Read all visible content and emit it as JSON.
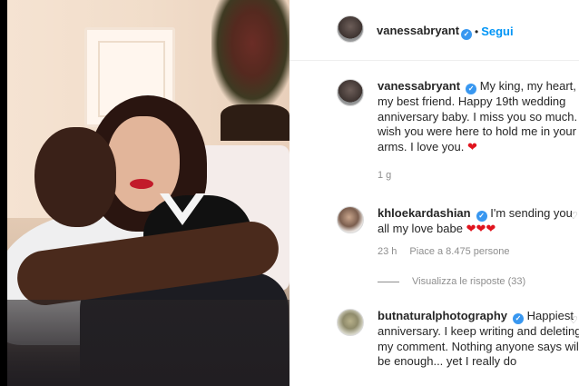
{
  "post": {
    "author": "vanessabryant",
    "follow_label": "Segui",
    "separator": "•"
  },
  "comments": [
    {
      "username": "vanessabryant",
      "text": "My king, my heart, my best friend. Happy 19th wedding anniversary baby. I miss you so much. I wish you were here to hold me in your arms. I love you.",
      "emoji": "❤",
      "time": "1 g"
    },
    {
      "username": "khloekardashian",
      "text": "I'm sending you all my love babe",
      "emoji": "❤❤❤",
      "time": "23 h",
      "likes": "Piace a 8.475 persone",
      "replies_label": "Visualizza le risposte (33)"
    },
    {
      "username": "butnaturalphotography",
      "text": "Happiest anniversary. I keep writing and deleting my comment. Nothing anyone says will be enough... yet I really do"
    }
  ],
  "icons": {
    "verified": "verified-badge-icon",
    "heart": "heart-icon",
    "like": "heart-outline-icon"
  },
  "colors": {
    "link": "#0095f6",
    "verified": "#3897f0",
    "heart": "#e0141e",
    "muted": "#8e8e8e"
  }
}
